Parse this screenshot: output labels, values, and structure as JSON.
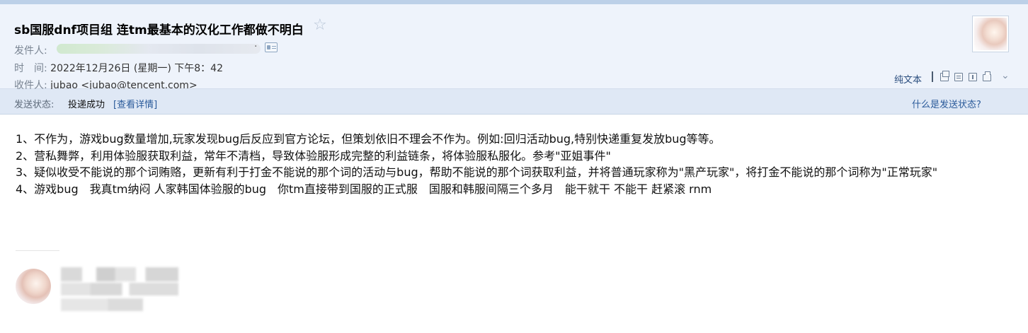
{
  "email": {
    "subject": "sb国服dnf项目组 连tm最基本的汉化工作都做不明白",
    "star_icon": "star-icon",
    "from_label": "发件人:",
    "time_label": "时　间:",
    "time_value": "2022年12月26日 (星期一) 下午8：42",
    "to_label": "收件人:",
    "to_value": "jubao <jubao@tencent.com>",
    "plain_text_label": "纯文本",
    "status_label": "发送状态:",
    "status_value": "投递成功",
    "status_details_link": "[查看详情]",
    "status_help_link": "什么是发送状态?",
    "body": [
      "1、不作为，游戏bug数量增加,玩家发现bug后反应到官方论坛，但策划依旧不理会不作为。例如:回归活动bug,特别快递重复发放bug等等。",
      "2、营私舞弊，利用体验服获取利益，常年不清档，导致体验服形成完整的利益链条，将体验服私服化。参考\"亚姐事件\"",
      "3、疑似收受不能说的那个词贿赂，更新有利于打金不能说的那个词的活动与bug，帮助不能说的那个词获取利益，并将普通玩家称为\"黑产玩家\"，将打金不能说的那个词称为\"正常玩家\"",
      "4、游戏bug　我真tm纳闷 人家韩国体验服的bug　你tm直接带到国服的正式服　国服和韩服间隔三个多月　能干就干 不能干 赶紧滚 rnm"
    ],
    "colors": {
      "header_bg": "#eef3fb",
      "status_bar_bg": "#dfe8f5",
      "link": "#2a5a9a"
    }
  }
}
